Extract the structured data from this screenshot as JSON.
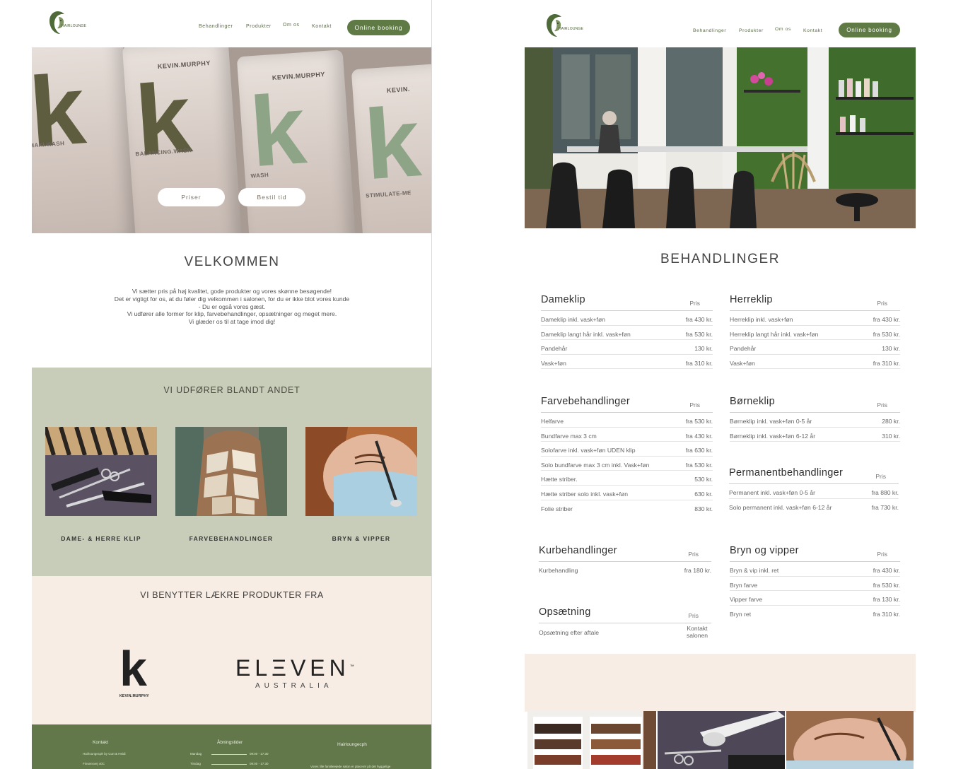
{
  "left": {
    "logo_text": "HAIRLOUNGE",
    "nav": [
      "Behandlinger",
      "Produkter",
      "Om os",
      "Kontakt"
    ],
    "booking_label": "Online booking",
    "hero": {
      "bottles": [
        {
          "brand": "",
          "name": "MAXI.WASH"
        },
        {
          "brand": "KEVIN.MURPHY",
          "name": "BALANCING.WASH"
        },
        {
          "brand": "KEVIN.MURPHY",
          "name": "WASH"
        },
        {
          "brand": "KEVIN.",
          "name": "STIMULATE-ME"
        }
      ],
      "btn_priser": "Priser",
      "btn_bestil": "Bestil tid"
    },
    "welcome_title": "VELKOMMEN",
    "intro_lines": [
      "Vi sætter pris på høj kvalitet, gode produkter og vores skønne besøgende!",
      "Det er vigtigt for os, at du føler dig velkommen i salonen, for du er ikke blot vores kunde",
      "- Du er også vores gæst.",
      "Vi udfører alle former for klip, farvebehandlinger, opsætninger og meget mere.",
      "Vi glæder os til at tage imod dig!"
    ],
    "services_title": "VI UDFØRER BLANDT ANDET",
    "services": [
      "DAME- & HERRE KLIP",
      "FARVEBEHANDLINGER",
      "BRYN & VIPPER"
    ],
    "brands_title": "VI BENYTTER LÆKRE PRODUKTER FRA",
    "brand_kevin": "KEVIN.MURPHY",
    "brand_eleven": "ELΞVEN",
    "brand_eleven_tm": "™",
    "brand_australia": "AUSTRALIA",
    "footer": {
      "kontakt": "Kontakt",
      "aabningstider": "Åbningstider",
      "hairloungecph": "Hairloungecph",
      "kontakt_line1": "Hairloungecph by Curt & Heidi",
      "kontakt_line2": "Finsensvej 40C",
      "day1": "Mandag",
      "time1": "09:00 - 17:30",
      "day2": "Tirsdag",
      "time2": "09:00 - 17:30",
      "about_line": "Vores lille familieejede salon er placeret på det hyggelige"
    }
  },
  "right": {
    "logo_text": "HAIRLOUNGE",
    "nav": [
      "Behandlinger",
      "Produkter",
      "Om os",
      "Kontakt"
    ],
    "booking_label": "Online booking",
    "title": "BEHANDLINGER",
    "pris_label": "Pris",
    "tables": {
      "dameklip": {
        "category": "Dameklip",
        "rows": [
          {
            "name": "Dameklip inkl. vask+føn",
            "price": "fra 430 kr."
          },
          {
            "name": "Dameklip langt hår inkl. vask+føn",
            "price": "fra 530 kr."
          },
          {
            "name": "Pandehår",
            "price": "130 kr."
          },
          {
            "name": "Vask+føn",
            "price": "fra 310 kr."
          }
        ]
      },
      "herreklip": {
        "category": "Herreklip",
        "rows": [
          {
            "name": "Herreklip inkl. vask+føn",
            "price": "fra 430 kr."
          },
          {
            "name": "Herreklip langt hår inkl. vask+føn",
            "price": "fra 530 kr."
          },
          {
            "name": "Pandehår",
            "price": "130 kr."
          },
          {
            "name": "Vask+føn",
            "price": "fra 310 kr."
          }
        ]
      },
      "farve": {
        "category": "Farvebehandlinger",
        "rows": [
          {
            "name": "Helfarve",
            "price": "fra 530 kr."
          },
          {
            "name": "Bundfarve max 3 cm",
            "price": "fra 430 kr."
          },
          {
            "name": "Solofarve inkl. vask+føn UDEN klip",
            "price": "fra 630 kr."
          },
          {
            "name": "Solo bundfarve max 3 cm inkl. Vask+føn",
            "price": "fra 530 kr."
          },
          {
            "name": "Hætte striber.",
            "price": "530 kr."
          },
          {
            "name": "Hætte striber solo inkl. vask+føn",
            "price": "630 kr."
          },
          {
            "name": "Folie striber",
            "price": "830 kr."
          }
        ]
      },
      "borne": {
        "category": "Børneklip",
        "rows": [
          {
            "name": "Børneklip inkl. vask+føn 0-5 år",
            "price": "280 kr."
          },
          {
            "name": "Børneklip inkl. vask+føn 6-12 år",
            "price": "310 kr."
          }
        ]
      },
      "perm": {
        "category": "Permanentbehandlinger",
        "rows": [
          {
            "name": "Permanent inkl. vask+føn 0-5 år",
            "price": "fra 880 kr."
          },
          {
            "name": "Solo permanent inkl. vask+føn 6-12 år",
            "price": "fra 730 kr."
          }
        ]
      },
      "kurb": {
        "category": "Kurbehandlinger",
        "rows": [
          {
            "name": "Kurbehandling",
            "price": "fra 180 kr."
          }
        ]
      },
      "bryn": {
        "category": "Bryn og vipper",
        "rows": [
          {
            "name": "Bryn & vip inkl. ret",
            "price": "fra 430 kr."
          },
          {
            "name": "Bryn farve",
            "price": "fra 530 kr."
          },
          {
            "name": "Vipper farve",
            "price": "fra 130 kr."
          },
          {
            "name": "Bryn ret",
            "price": "fra 310 kr."
          }
        ]
      },
      "ops": {
        "category": "Opsætning",
        "rows": [
          {
            "name": "Opsætning efter aftale",
            "price": "Kontakt salonen"
          }
        ]
      }
    }
  },
  "colors": {
    "brand_green": "#5f7a45",
    "sage": "#c8cdb9",
    "beige": "#f7ede4",
    "footer_green": "#62784a"
  }
}
